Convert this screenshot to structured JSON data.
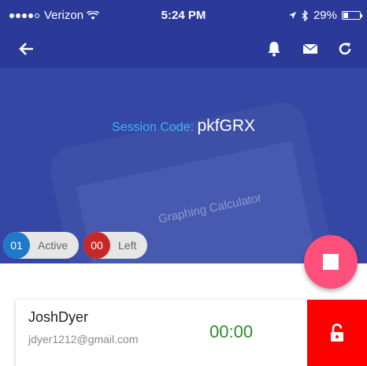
{
  "status_bar": {
    "carrier": "Verizon",
    "time": "5:24 PM",
    "battery_pct": "29%",
    "battery_level": 0.29
  },
  "toolbar": {
    "back_icon": "arrow-left-icon",
    "icons": [
      "bell-icon",
      "envelope-icon",
      "refresh-icon"
    ]
  },
  "session": {
    "label": "Session Code:",
    "code": "pkfGRX"
  },
  "background_phone_text": "Graphing Calculator",
  "stats": {
    "active": {
      "count": "01",
      "label": "Active",
      "color": "#1e7ac8"
    },
    "left": {
      "count": "00",
      "label": "Left",
      "color": "#c62828"
    }
  },
  "student": {
    "name": "JoshDyer",
    "email": "jdyer1212@gmail.com",
    "timer": "00:00"
  },
  "colors": {
    "header": "#2b3a98",
    "hero": "#3547a4",
    "session_label": "#39b4ff",
    "fab": "#ff4f7b",
    "unlock": "#ff0000",
    "timer": "#2e8b2e"
  }
}
